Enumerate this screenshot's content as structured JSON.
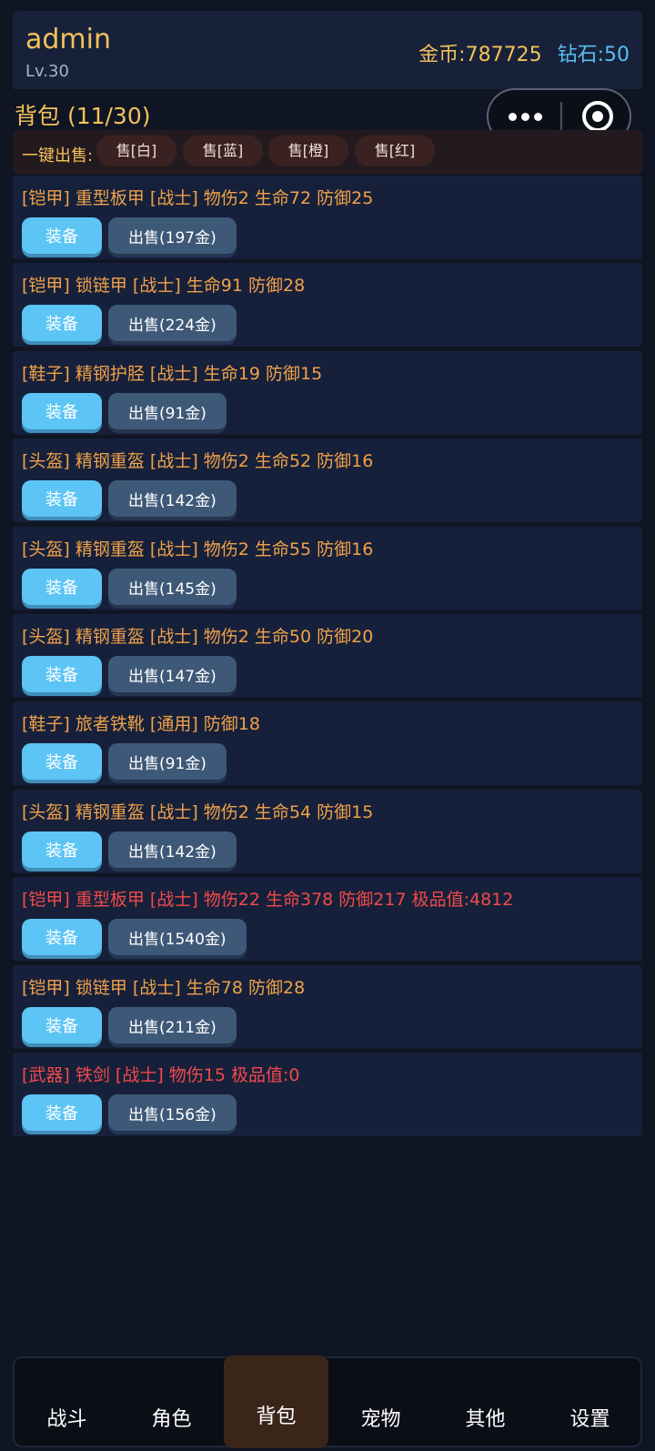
{
  "header": {
    "username": "admin",
    "level": "Lv.30",
    "gold": "金币:787725",
    "diamond": "钻石:50"
  },
  "bag": {
    "title": "背包 (11/30)"
  },
  "quick_sell": {
    "label": "一键出售:",
    "buttons": [
      "售[白]",
      "售[蓝]",
      "售[橙]",
      "售[红]"
    ]
  },
  "items": [
    {
      "text": "[铠甲] 重型板甲 [战士] 物伤2 生命72 防御25",
      "quality": "orange",
      "equip_label": "装备",
      "sell_label": "出售(197金)"
    },
    {
      "text": "[铠甲] 锁链甲 [战士] 生命91 防御28",
      "quality": "orange",
      "equip_label": "装备",
      "sell_label": "出售(224金)"
    },
    {
      "text": "[鞋子] 精钢护胫 [战士] 生命19 防御15",
      "quality": "orange",
      "equip_label": "装备",
      "sell_label": "出售(91金)"
    },
    {
      "text": "[头盔] 精钢重盔 [战士] 物伤2 生命52 防御16",
      "quality": "orange",
      "equip_label": "装备",
      "sell_label": "出售(142金)"
    },
    {
      "text": "[头盔] 精钢重盔 [战士] 物伤2 生命55 防御16",
      "quality": "orange",
      "equip_label": "装备",
      "sell_label": "出售(145金)"
    },
    {
      "text": "[头盔] 精钢重盔 [战士] 物伤2 生命50 防御20",
      "quality": "orange",
      "equip_label": "装备",
      "sell_label": "出售(147金)"
    },
    {
      "text": "[鞋子] 旅者铁靴 [通用] 防御18",
      "quality": "orange",
      "equip_label": "装备",
      "sell_label": "出售(91金)"
    },
    {
      "text": "[头盔] 精钢重盔 [战士] 物伤2 生命54 防御15",
      "quality": "orange",
      "equip_label": "装备",
      "sell_label": "出售(142金)"
    },
    {
      "text": "[铠甲] 重型板甲 [战士] 物伤22 生命378 防御217 极品值:4812",
      "quality": "red",
      "equip_label": "装备",
      "sell_label": "出售(1540金)"
    },
    {
      "text": "[铠甲] 锁链甲 [战士] 生命78 防御28",
      "quality": "orange",
      "equip_label": "装备",
      "sell_label": "出售(211金)"
    },
    {
      "text": "[武器] 铁剑 [战士] 物伤15 极品值:0",
      "quality": "red",
      "equip_label": "装备",
      "sell_label": "出售(156金)"
    }
  ],
  "nav": {
    "tabs": [
      "战斗",
      "角色",
      "背包",
      "宠物",
      "其他",
      "设置"
    ],
    "active": "背包"
  },
  "colors": {
    "accent_gold": "#f4c15a",
    "diamond_blue": "#59bff0",
    "orange_quality": "#f0a149",
    "red_quality": "#f24a4a",
    "equip_button": "#5cc5f5",
    "sell_button": "#3e5978"
  },
  "icons": [
    "more-dots-icon",
    "target-icon"
  ]
}
